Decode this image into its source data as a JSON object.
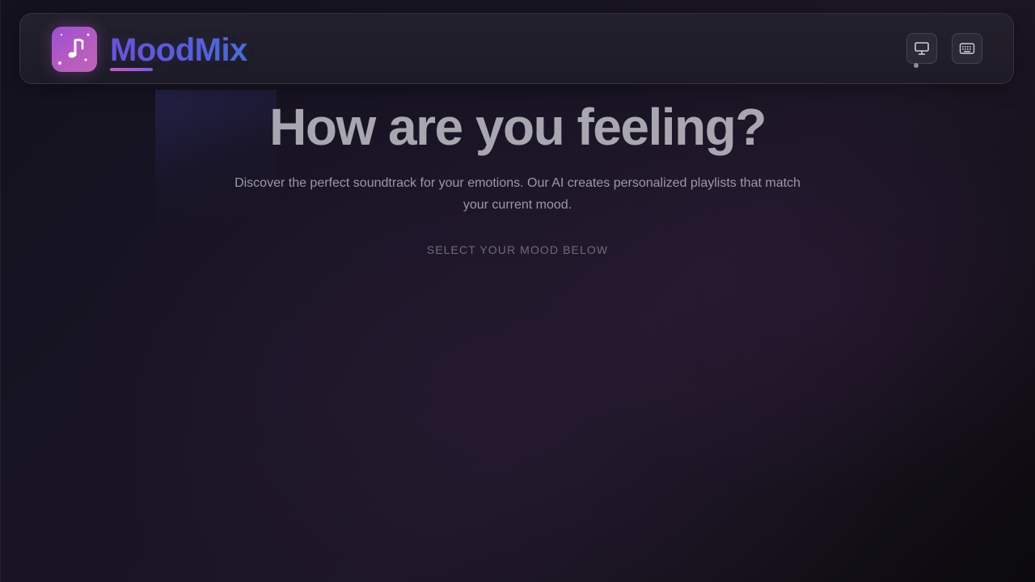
{
  "app": {
    "name": "MoodMix",
    "logo_icon": "music-note-icon"
  },
  "header": {
    "buttons": [
      {
        "icon": "monitor-icon",
        "role": "display"
      },
      {
        "icon": "keyboard-icon",
        "role": "keyboard"
      }
    ]
  },
  "hero": {
    "title": "How are you feeling?",
    "description": "Discover the perfect soundtrack for your emotions. Our AI creates personalized playlists that match your current mood.",
    "hint": "SELECT YOUR MOOD BELOW"
  },
  "colors": {
    "brand_gradient_start": "#6d54d9",
    "brand_gradient_end": "#4a6fd6",
    "logo_icon_start": "#9a4fd6",
    "logo_icon_end": "#c064b6",
    "accent_underline": "#c45ac0",
    "background": "#181424"
  }
}
